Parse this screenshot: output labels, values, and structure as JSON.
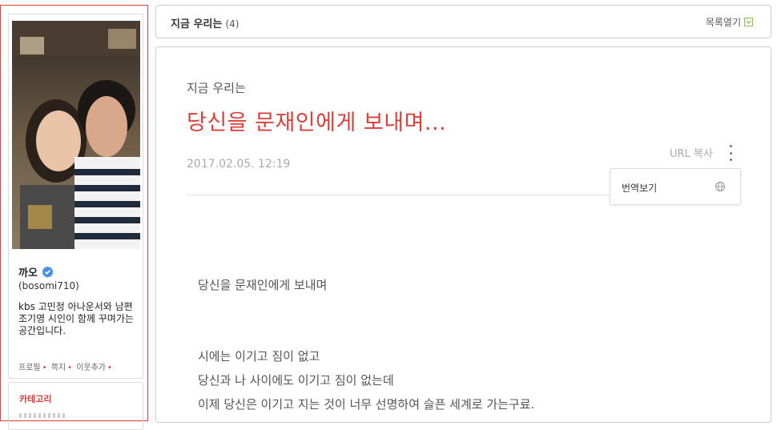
{
  "sidebar": {
    "profile": {
      "name": "까오",
      "id": "(bosomi710)",
      "description": "kbs 고민정 아나운서와 남편 조기영 시인이 함께 꾸며가는 공간입니다.",
      "links": [
        "프로필",
        "쪽지",
        "이웃추가"
      ],
      "verified_color": "#4a90e2"
    },
    "category_title": "카테고리"
  },
  "list_bar": {
    "title": "지금 우리는",
    "count": "(4)",
    "toggle_label": "목록열기",
    "toggle_color": "#8bc34a"
  },
  "post": {
    "category": "지금 우리는",
    "title": "당신을 문재인에게 보내며...",
    "date": "2017.02.05. 12:19",
    "url_copy": "URL 복사",
    "translate_label": "번역보기",
    "body": [
      "당신을 문재인에게 보내며",
      "시에는 이기고 짐이 없고",
      "당신과 나 사이에도 이기고 짐이 없는데",
      "이제 당신은 이기고 지는 것이 너무 선명하여 슬픈 세계로 가는구료."
    ],
    "title_color": "#d9413a"
  }
}
